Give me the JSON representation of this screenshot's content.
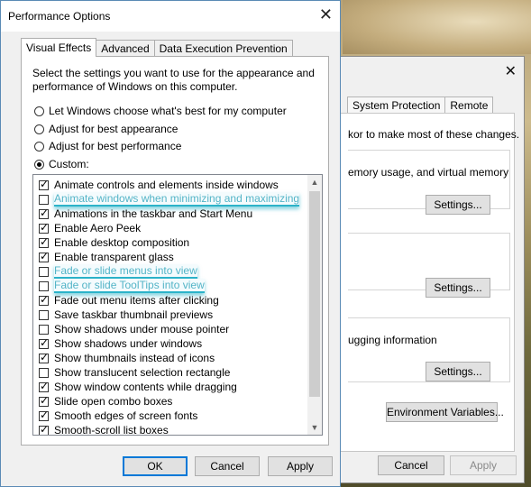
{
  "background_dialog": {
    "tabs": [
      "System Protection",
      "Remote"
    ],
    "line1": "kor to make most of these changes.",
    "line2": "emory usage, and virtual memory",
    "line3": "ugging information",
    "settings_label": "Settings...",
    "env_button": "Environment Variables...",
    "cancel": "Cancel",
    "apply": "Apply",
    "close_symbol": "✕"
  },
  "dialog": {
    "title": "Performance Options",
    "close_symbol": "✕",
    "tabs": [
      "Visual Effects",
      "Advanced",
      "Data Execution Prevention"
    ],
    "description": "Select the settings you want to use for the appearance and performance of Windows on this computer.",
    "radios": [
      {
        "label": "Let Windows choose what's best for my computer",
        "selected": false
      },
      {
        "label": "Adjust for best appearance",
        "selected": false
      },
      {
        "label": "Adjust for best performance",
        "selected": false
      },
      {
        "label": "Custom:",
        "selected": true
      }
    ],
    "effects": [
      {
        "label": "Animate controls and elements inside windows",
        "checked": true,
        "highlighted": false
      },
      {
        "label": "Animate windows when minimizing and maximizing",
        "checked": false,
        "highlighted": true
      },
      {
        "label": "Animations in the taskbar and Start Menu",
        "checked": true,
        "highlighted": false
      },
      {
        "label": "Enable Aero Peek",
        "checked": true,
        "highlighted": false
      },
      {
        "label": "Enable desktop composition",
        "checked": true,
        "highlighted": false
      },
      {
        "label": "Enable transparent glass",
        "checked": true,
        "highlighted": false
      },
      {
        "label": "Fade or slide menus into view",
        "checked": false,
        "highlighted": true
      },
      {
        "label": "Fade or slide ToolTips into view",
        "checked": false,
        "highlighted": true
      },
      {
        "label": "Fade out menu items after clicking",
        "checked": true,
        "highlighted": false
      },
      {
        "label": "Save taskbar thumbnail previews",
        "checked": false,
        "highlighted": false
      },
      {
        "label": "Show shadows under mouse pointer",
        "checked": false,
        "highlighted": false
      },
      {
        "label": "Show shadows under windows",
        "checked": true,
        "highlighted": false
      },
      {
        "label": "Show thumbnails instead of icons",
        "checked": true,
        "highlighted": false
      },
      {
        "label": "Show translucent selection rectangle",
        "checked": false,
        "highlighted": false
      },
      {
        "label": "Show window contents while dragging",
        "checked": true,
        "highlighted": false
      },
      {
        "label": "Slide open combo boxes",
        "checked": true,
        "highlighted": false
      },
      {
        "label": "Smooth edges of screen fonts",
        "checked": true,
        "highlighted": false
      },
      {
        "label": "Smooth-scroll list boxes",
        "checked": true,
        "highlighted": false
      }
    ],
    "buttons": {
      "ok": "OK",
      "cancel": "Cancel",
      "apply": "Apply"
    },
    "scroll_up": "▲",
    "scroll_down": "▼"
  },
  "colors": {
    "highlight": "#2cb3c9",
    "accent": "#0078d7"
  }
}
